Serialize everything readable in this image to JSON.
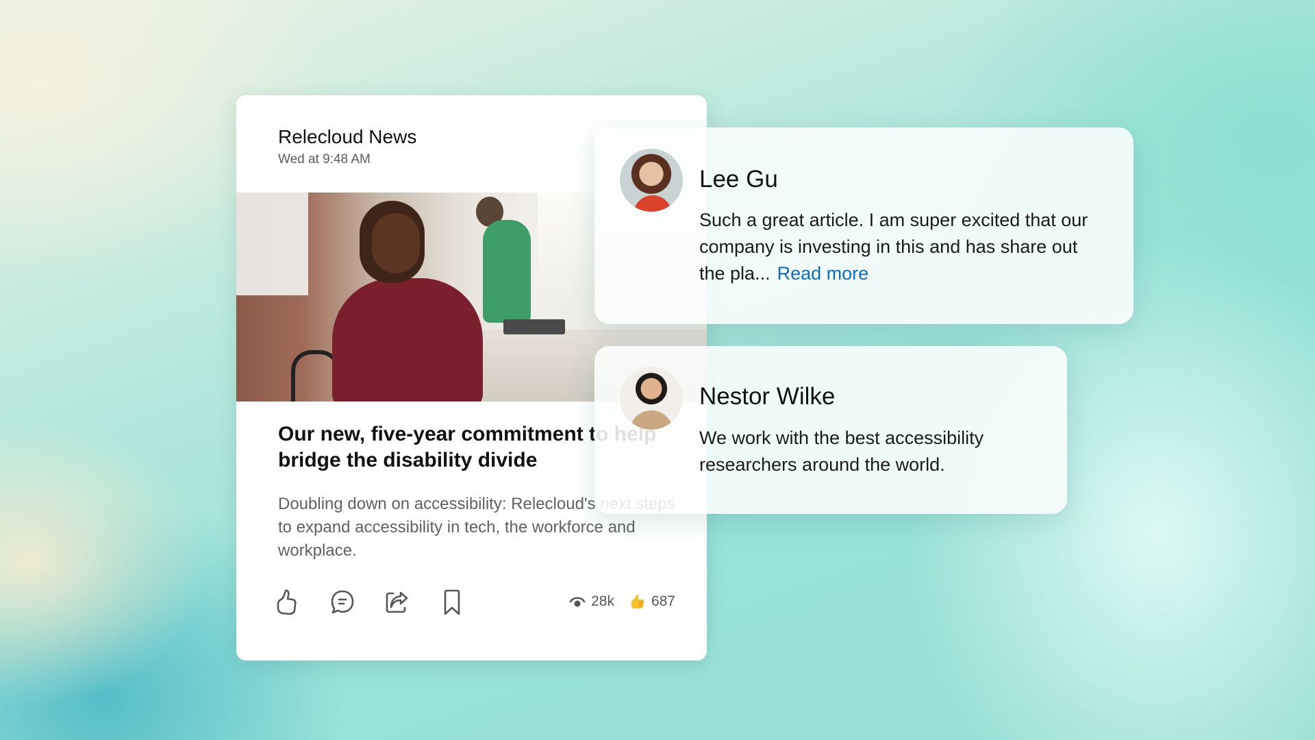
{
  "news_card": {
    "source": "Relecloud News",
    "timestamp": "Wed at 9:48 AM",
    "photo_alt": "Smiling woman in a wheelchair at an office desk",
    "headline": "Our new, five-year commitment to help bridge the disability divide",
    "summary": "Doubling down on accessibility: Relecloud's next steps to expand accessibility in tech, the workforce and workplace.",
    "actions": [
      {
        "name": "like",
        "icon": "thumbs-up-icon"
      },
      {
        "name": "comment",
        "icon": "comment-icon"
      },
      {
        "name": "share",
        "icon": "share-icon"
      },
      {
        "name": "bookmark",
        "icon": "bookmark-icon"
      }
    ],
    "stats": {
      "views": "28k",
      "views_icon": "eye-icon",
      "likes": "687",
      "likes_icon": "thumbs-up-emoji"
    }
  },
  "comments": [
    {
      "author": "Lee Gu",
      "text": "Such a great article. I am super excited that our company is investing in this and has share out the pla...",
      "link": "Read more"
    },
    {
      "author": "Nestor Wilke",
      "text": "We work with the best accessibility researchers around the world."
    }
  ],
  "colors": {
    "link": "#0f6cbd",
    "like_emoji": "#f5c02b",
    "icon_stroke": "#555555"
  }
}
